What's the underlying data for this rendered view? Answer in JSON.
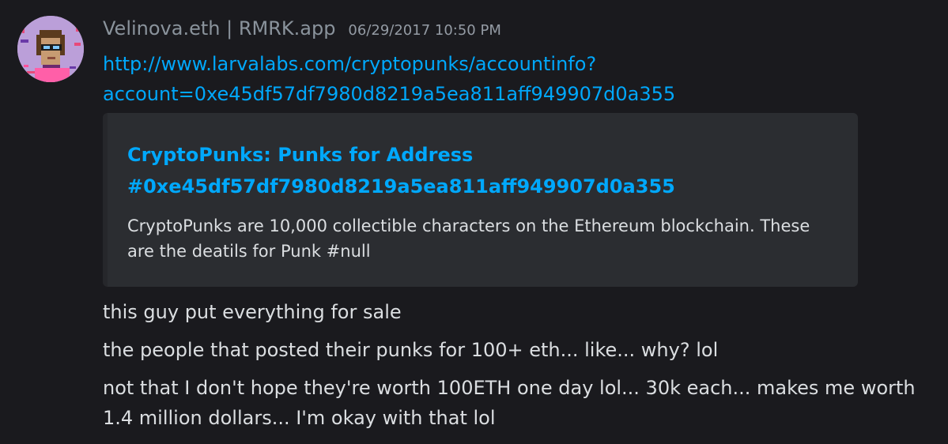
{
  "author": {
    "name": "Velinova.eth | RMRK.app",
    "timestamp": "06/29/2017 10:50 PM"
  },
  "link": {
    "line1": "http://www.larvalabs.com/cryptopunks/accountinfo?",
    "line2": "account=0xe45df57df7980d8219a5ea811aff949907d0a355"
  },
  "embed": {
    "title_line1": "CryptoPunks: Punks for Address",
    "title_line2": "#0xe45df57df7980d8219a5ea811aff949907d0a355",
    "description_line1": "CryptoPunks are 10,000 collectible characters on the Ethereum blockchain. These",
    "description_line2": "are the deatils for Punk #null"
  },
  "messages": [
    {
      "line1": "this guy put everything for sale"
    },
    {
      "line1": "the people that posted their punks for 100+ eth... like... why? lol"
    },
    {
      "line1": "not that I don't hope they're worth 100ETH one day lol... 30k each... makes me worth",
      "line2": "1.4 million dollars... I'm okay with that lol"
    }
  ],
  "colors": {
    "background": "#1a1a1e",
    "link": "#00a8fc",
    "username": "#8a939c",
    "text": "#dbdee1",
    "embed_background": "#2b2d31"
  },
  "icons": {
    "avatar": "pixel-punk-avatar"
  }
}
